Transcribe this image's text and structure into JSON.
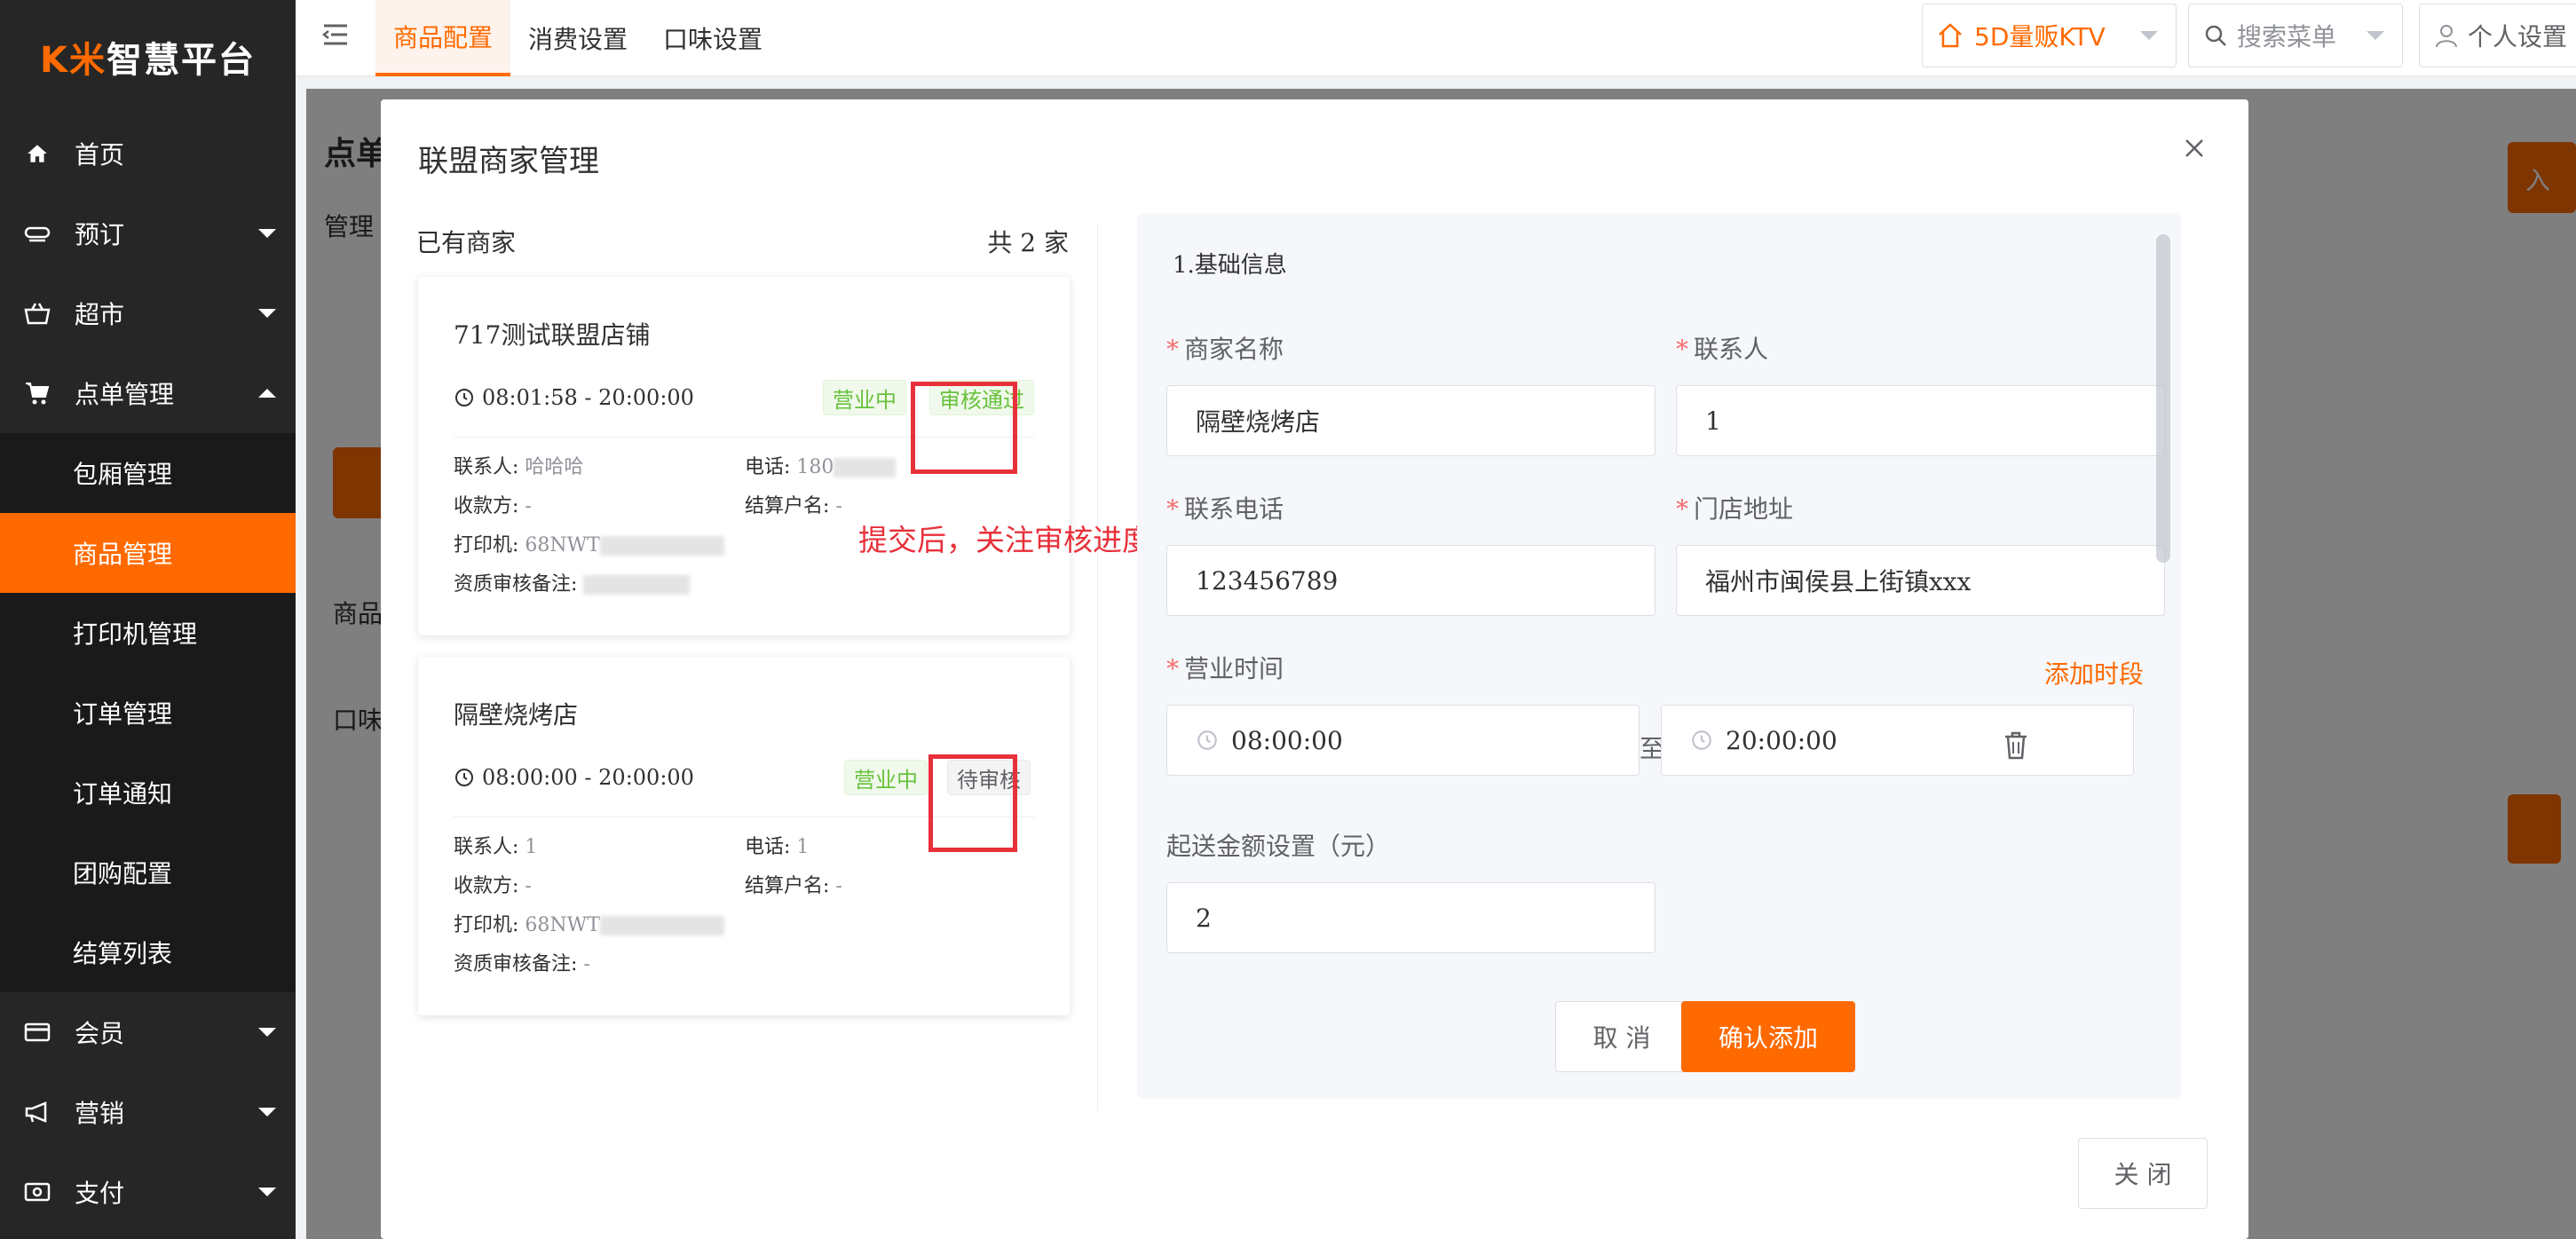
{
  "logo": {
    "kw": "K米",
    "text": "智慧平台"
  },
  "sidebar": {
    "items": [
      {
        "label": "首页",
        "icon": "home-icon"
      },
      {
        "label": "预订",
        "icon": "reserve-icon"
      },
      {
        "label": "超市",
        "icon": "basket-icon"
      },
      {
        "label": "点单管理",
        "icon": "cart-icon"
      },
      {
        "label": "会员",
        "icon": "card-icon"
      },
      {
        "label": "营销",
        "icon": "megaphone-icon"
      },
      {
        "label": "支付",
        "icon": "payment-icon"
      }
    ],
    "sub_items": [
      {
        "label": "包厢管理"
      },
      {
        "label": "商品管理"
      },
      {
        "label": "打印机管理"
      },
      {
        "label": "订单管理"
      },
      {
        "label": "订单通知"
      },
      {
        "label": "团购配置"
      },
      {
        "label": "结算列表"
      }
    ]
  },
  "topbar": {
    "tabs": [
      "商品配置",
      "消费设置",
      "口味设置"
    ],
    "store": "5D量贩KTV",
    "search_placeholder": "搜索菜单",
    "user": "个人设置"
  },
  "background": {
    "frag1": "点单",
    "frag2": "管理",
    "frag3": "商品",
    "frag4": "口味",
    "frag5": "入"
  },
  "dialog": {
    "title": "联盟商家管理",
    "close_button": "关 闭",
    "left": {
      "title": "已有商家",
      "count": "共 2 家",
      "merchants": [
        {
          "name": "717测试联盟店铺",
          "time": "08:01:58 - 20:00:00",
          "status": "营业中",
          "review": "审核通过",
          "contact_label": "联系人:",
          "contact": "哈哈哈",
          "phone_label": "电话:",
          "phone": "180",
          "payee_label": "收款方:",
          "payee": "-",
          "account_label": "结算户名:",
          "account": "-",
          "printer_label": "打印机:",
          "printer": "68NWT",
          "remark_label": "资质审核备注:",
          "remark": ""
        },
        {
          "name": "隔壁烧烤店",
          "time": "08:00:00 - 20:00:00",
          "status": "营业中",
          "review": "待审核",
          "contact_label": "联系人:",
          "contact": "1",
          "phone_label": "电话:",
          "phone": "1",
          "payee_label": "收款方:",
          "payee": "-",
          "account_label": "结算户名:",
          "account": "-",
          "printer_label": "打印机:",
          "printer": "68NWT",
          "remark_label": "资质审核备注:",
          "remark": "-"
        }
      ],
      "annotation": "提交后，关注审核进度"
    },
    "form": {
      "section": "1.基础信息",
      "name_label": "商家名称",
      "name_value": "隔壁烧烤店",
      "contact_label": "联系人",
      "contact_value": "1",
      "phone_label": "联系电话",
      "phone_value": "123456789",
      "address_label": "门店地址",
      "address_value": "福州市闽侯县上街镇xxx",
      "hours_label": "营业时间",
      "add_period": "添加时段",
      "start_time": "08:00:00",
      "to": "至",
      "end_time": "20:00:00",
      "min_amount_label": "起送金额设置（元）",
      "min_amount_value": "2",
      "cancel": "取 消",
      "confirm": "确认添加"
    }
  },
  "colors": {
    "accent": "#ff6a00",
    "sidebar": "#262626",
    "annotation": "#e8303a"
  }
}
